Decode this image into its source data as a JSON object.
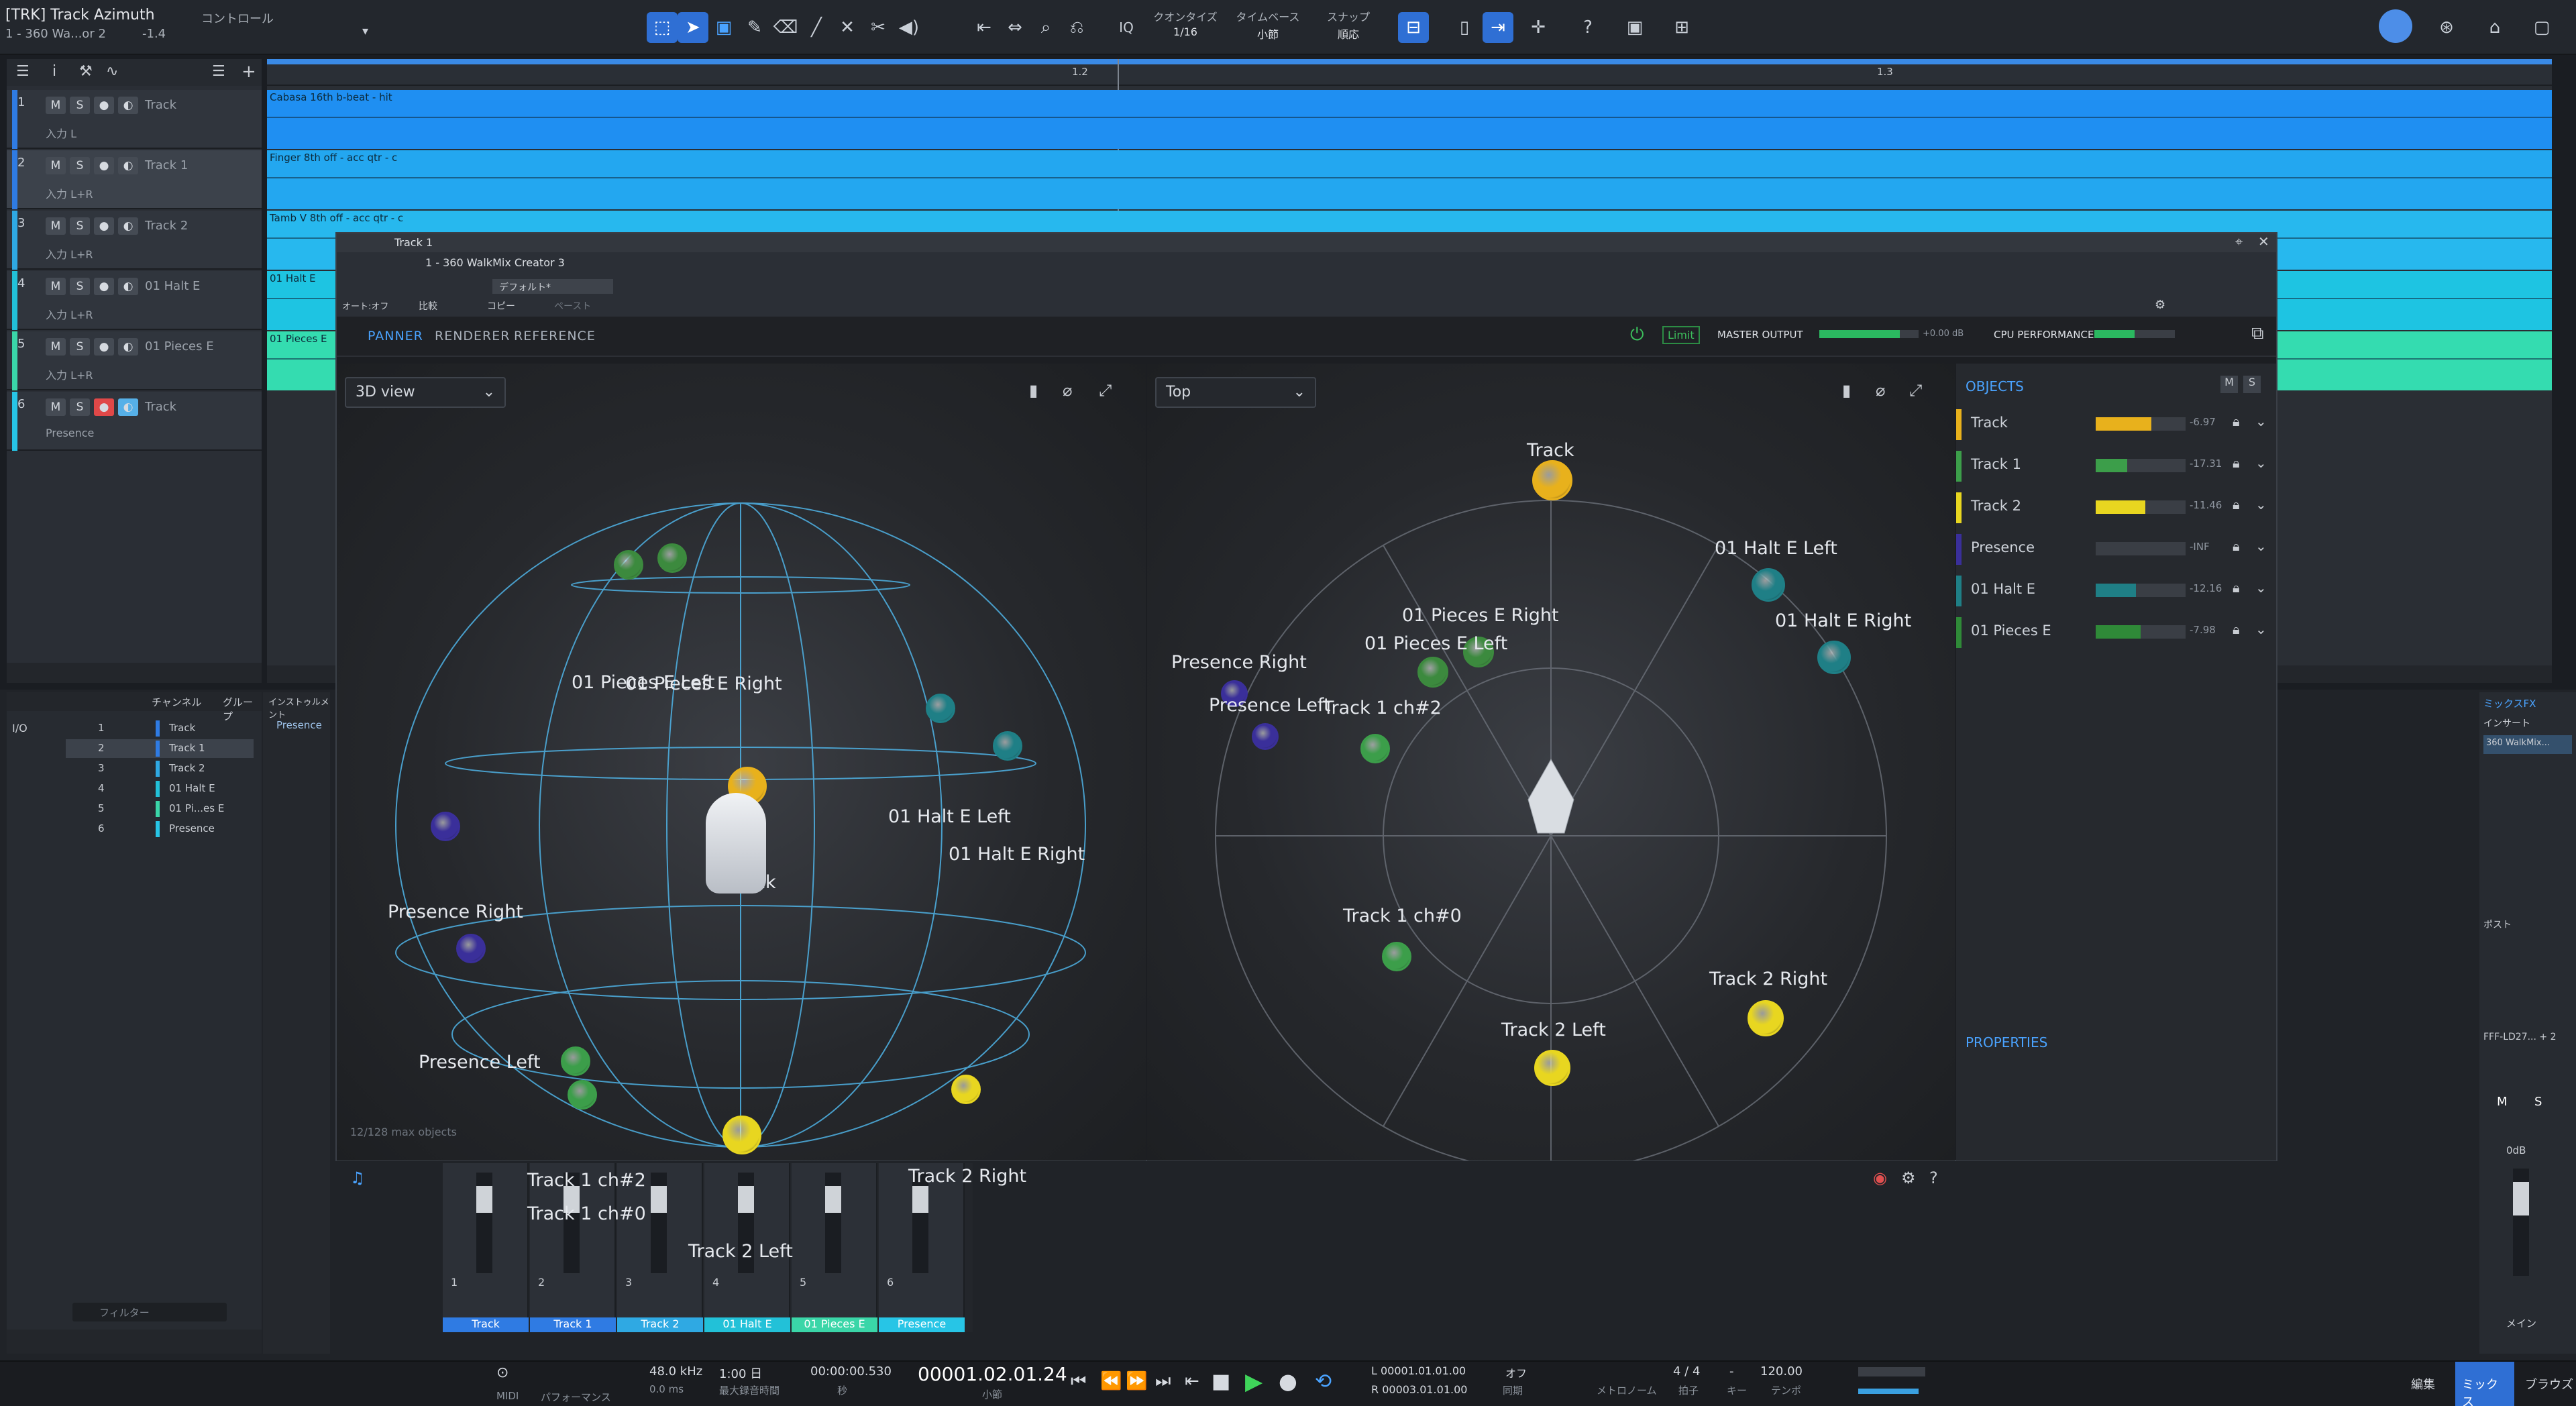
{
  "window": {
    "title": "[TRK] Track Azimuth",
    "subtitle": "1 - 360 Wa...or 2",
    "subval": "-1.4",
    "control": "コントロール"
  },
  "toolbar": {
    "quantize_label": "クオンタイズ",
    "quantize_val": "1/16",
    "timebase_label": "タイムベース",
    "timebase_val": "小節",
    "snap_label": "スナップ",
    "snap_val": "順応"
  },
  "tracks": [
    {
      "num": "1",
      "name": "Track",
      "input": "入力 L",
      "color": "#2f7be3"
    },
    {
      "num": "2",
      "name": "Track 1",
      "input": "入力 L+R",
      "color": "#2f7be3"
    },
    {
      "num": "3",
      "name": "Track 2",
      "input": "入力 L+R",
      "color": "#2fa9e3"
    },
    {
      "num": "4",
      "name": "01 Halt E",
      "input": "入力 L+R",
      "color": "#22c1d8"
    },
    {
      "num": "5",
      "name": "01 Pieces E",
      "input": "入力 L+R",
      "color": "#3ad6a8"
    },
    {
      "num": "6",
      "name": "Track",
      "input": "Presence",
      "color": "#27c5e6"
    }
  ],
  "ruler": {
    "m1": "1.2",
    "m2": "1.3"
  },
  "clips": [
    {
      "label": "Cabasa 16th b-beat - hit",
      "color": "#1f8ff2"
    },
    {
      "label": "Finger 8th off - acc qtr - c",
      "color": "#23a7f0"
    },
    {
      "label": "Tamb V 8th off - acc qtr - c",
      "color": "#27b8ee"
    },
    {
      "label": "01 Halt E",
      "color": "#1ec4e2"
    },
    {
      "label": "01 Pieces E",
      "color": "#34dcb0"
    }
  ],
  "plugin": {
    "title": "Track 1",
    "device": "1 - 360 WalkMix Creator 3",
    "preset": "デフォルト*",
    "auto": "オート:オフ",
    "compare": "比較",
    "copy": "コピー",
    "paste": "ペースト",
    "tabs": [
      "PANNER",
      "RENDERER",
      "REFERENCE"
    ],
    "limit": "Limit",
    "master": "MASTER OUTPUT",
    "master_val": "+0.00 dB",
    "cpu": "CPU PERFORMANCE",
    "view3d": "3D view",
    "viewtop": "Top",
    "maxobj": "12/128 max objects",
    "objects_title": "OBJECTS",
    "properties": "PROPERTIES",
    "m": "M",
    "s": "S"
  },
  "objects": [
    {
      "name": "Track",
      "color": "#e8b11c",
      "val": "-6.97",
      "level": 0.62
    },
    {
      "name": "Track 1",
      "color": "#3c9e4a",
      "val": "-17.31",
      "level": 0.35
    },
    {
      "name": "Track 2",
      "color": "#e8d620",
      "val": "-11.46",
      "level": 0.55
    },
    {
      "name": "Presence",
      "color": "#3a2f9a",
      "val": "-INF",
      "level": 0.0
    },
    {
      "name": "01 Halt E",
      "color": "#1f7f86",
      "val": "-12.16",
      "level": 0.45
    },
    {
      "name": "01 Pieces E",
      "color": "#2f8a38",
      "val": "-7.98",
      "level": 0.5
    }
  ],
  "labels3d": {
    "pieces": "01 Pieces E Left",
    "pieces_r": "01 Pieces E Right",
    "halt_l": "01 Halt E Left",
    "halt_r": "01 Halt E Right",
    "track": "Track",
    "pres_r": "Presence Right",
    "pres_l": "Presence Left",
    "t1c2": "Track 1 ch#2",
    "t1c0": "Track 1 ch#0",
    "t2l": "Track 2 Left",
    "t2r": "Track 2 Right"
  },
  "console": {
    "list": [
      "Track",
      "Track 1",
      "Track 2",
      "01 Halt E",
      "01 Pi...es E",
      "Presence"
    ],
    "channel": "チャンネル",
    "group": "グループ",
    "instrument": "インストゥルメント",
    "presence": "Presence",
    "filter": "フィルター",
    "mixfx": "ミックスFX",
    "insert": "インサート",
    "post": "ポスト",
    "dev": "360 WalkMix...",
    "bus": "FFF-LD27... + 2",
    "odb": "0dB",
    "main": "メイン"
  },
  "strips": [
    {
      "num": "1",
      "name": "Track",
      "color": "#2f7be3"
    },
    {
      "num": "2",
      "name": "Track 1",
      "color": "#2f7be3"
    },
    {
      "num": "3",
      "name": "Track 2",
      "color": "#2fa9e3"
    },
    {
      "num": "4",
      "name": "01 Halt E",
      "color": "#22c1d8"
    },
    {
      "num": "5",
      "name": "01 Pieces E",
      "color": "#3ad6a8"
    },
    {
      "num": "6",
      "name": "Presence",
      "color": "#27c5e6"
    }
  ],
  "transport": {
    "midi": "MIDI",
    "perf": "パフォーマンス",
    "rate": "48.0 kHz",
    "lat": "0.0 ms",
    "rec": "1:00 日",
    "rec_sub": "最大録音時間",
    "time": "00:00:00.530",
    "time_sub": "秒",
    "pos": "00001.02.01.24",
    "pos_sub": "小節",
    "l": "00001.01.01.00",
    "r": "00003.01.01.00",
    "off": "オフ",
    "sync": "同期",
    "metro": "メトロノーム",
    "sig": "4 / 4",
    "sig_sub": "拍子",
    "key": "-",
    "key_sub": "キー",
    "tempo": "120.00",
    "tempo_sub": "テンポ",
    "edit": "編集",
    "mix": "ミックス",
    "browse": "ブラウズ"
  }
}
